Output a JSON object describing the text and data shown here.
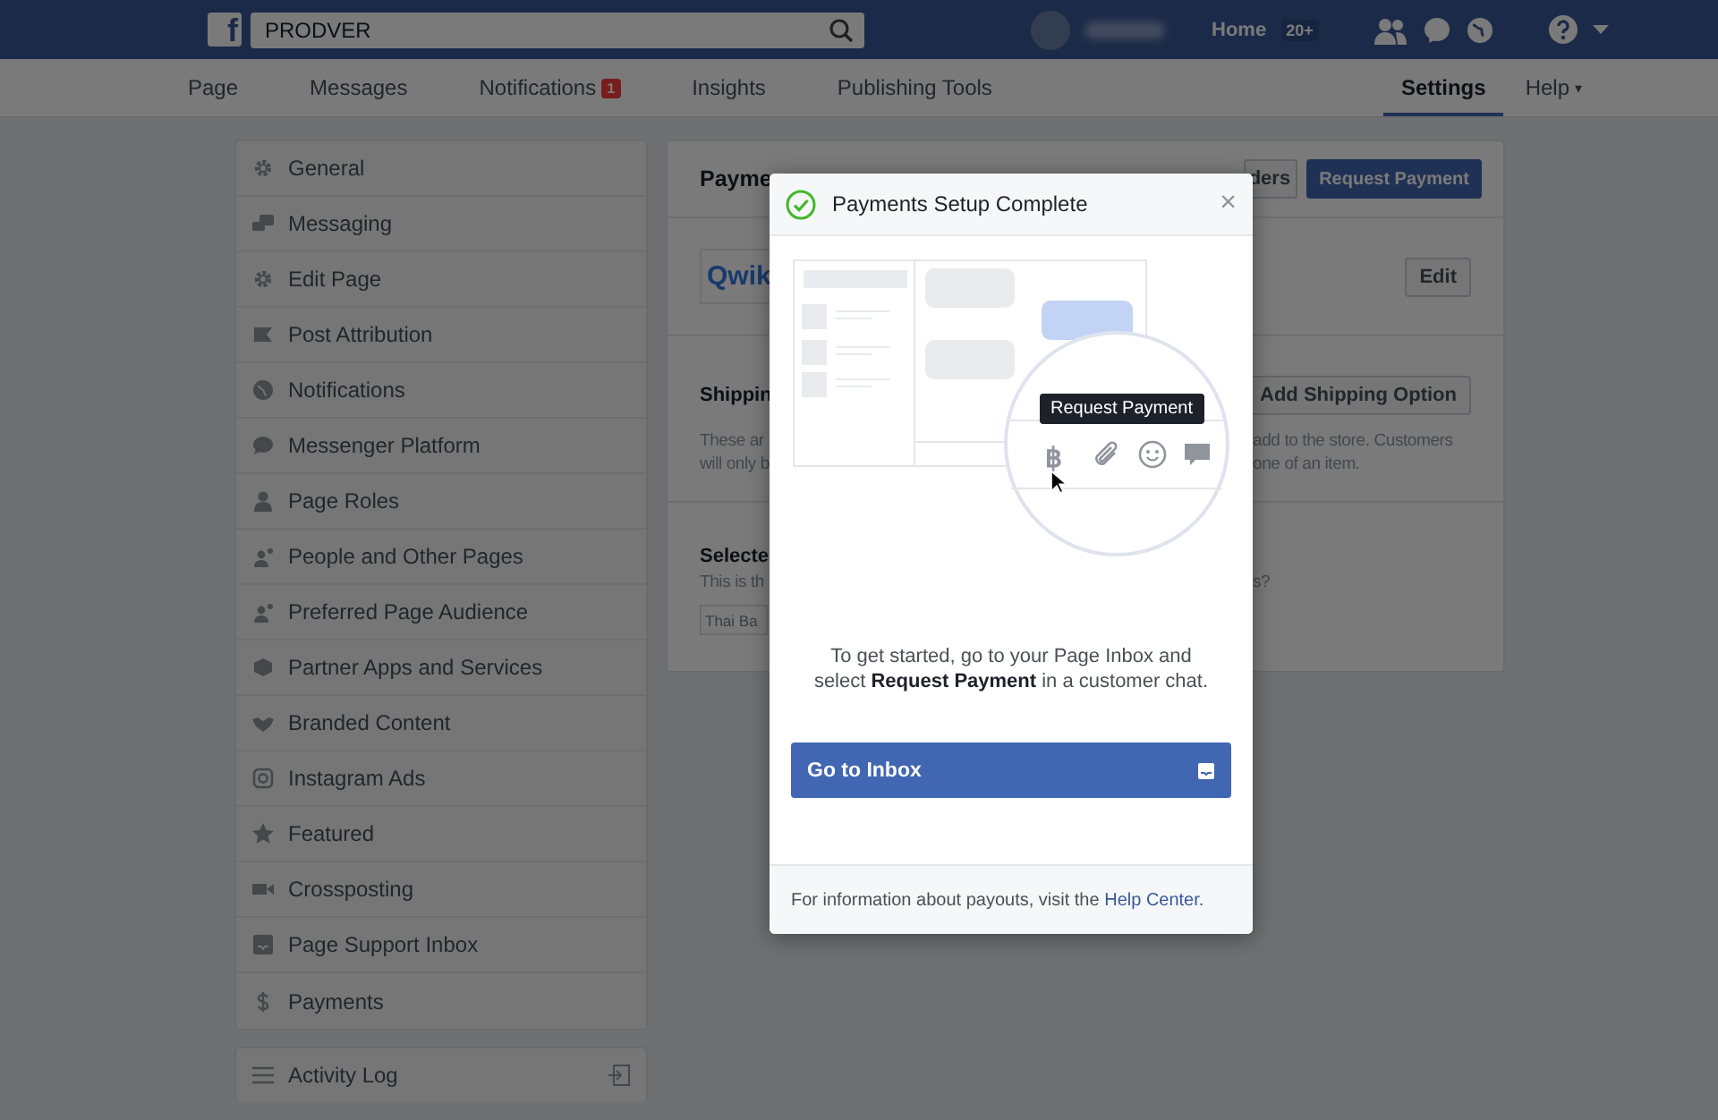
{
  "topbar": {
    "logo": "f",
    "search": {
      "value": "PRODVER"
    },
    "home": "Home",
    "home_badge": "20+"
  },
  "nav": {
    "tabs": [
      {
        "label": "Page",
        "selected": false
      },
      {
        "label": "Messages",
        "selected": false
      },
      {
        "label": "Notifications",
        "selected": false,
        "badge": "1"
      },
      {
        "label": "Insights",
        "selected": false
      },
      {
        "label": "Publishing Tools",
        "selected": false
      }
    ],
    "right_tabs": [
      {
        "label": "Settings",
        "selected": true
      },
      {
        "label": "Help",
        "selected": false,
        "caret": "▾"
      }
    ]
  },
  "sidebar": {
    "items": [
      {
        "label": "General"
      },
      {
        "label": "Messaging"
      },
      {
        "label": "Edit Page"
      },
      {
        "label": "Post Attribution"
      },
      {
        "label": "Notifications"
      },
      {
        "label": "Messenger Platform"
      },
      {
        "label": "Page Roles"
      },
      {
        "label": "People and Other Pages"
      },
      {
        "label": "Preferred Page Audience"
      },
      {
        "label": "Partner Apps and Services"
      },
      {
        "label": "Branded Content"
      },
      {
        "label": "Instagram Ads"
      },
      {
        "label": "Featured"
      },
      {
        "label": "Crossposting"
      },
      {
        "label": "Page Support Inbox"
      },
      {
        "label": "Payments"
      }
    ],
    "activity_log": "Activity Log"
  },
  "panel": {
    "title": "Payme",
    "orders_button": "ders",
    "request_button": "Request Payment",
    "logo": "Qwik",
    "edit_button": "Edit",
    "shipping": {
      "title": "Shippin",
      "button": "Add Shipping Option",
      "left_lines": [
        "These ar",
        "will only b"
      ],
      "right_lines": [
        "add to the store. Customers",
        "one of an item."
      ]
    },
    "selected": {
      "title": "Selecte",
      "left_line": "This is th",
      "right_line": "s?",
      "field_placeholder": "Thai Ba"
    }
  },
  "modal": {
    "title": "Payments Setup Complete",
    "close": "×",
    "tooltip": "Request Payment",
    "payment_glyph": "฿",
    "message": "To get started, go to your Page Inbox and select **Request Payment** in a customer chat.",
    "button": "Go to Inbox",
    "footer": "For information about payouts, visit the ",
    "footer_link": "Help Center",
    "footer_end": "."
  }
}
